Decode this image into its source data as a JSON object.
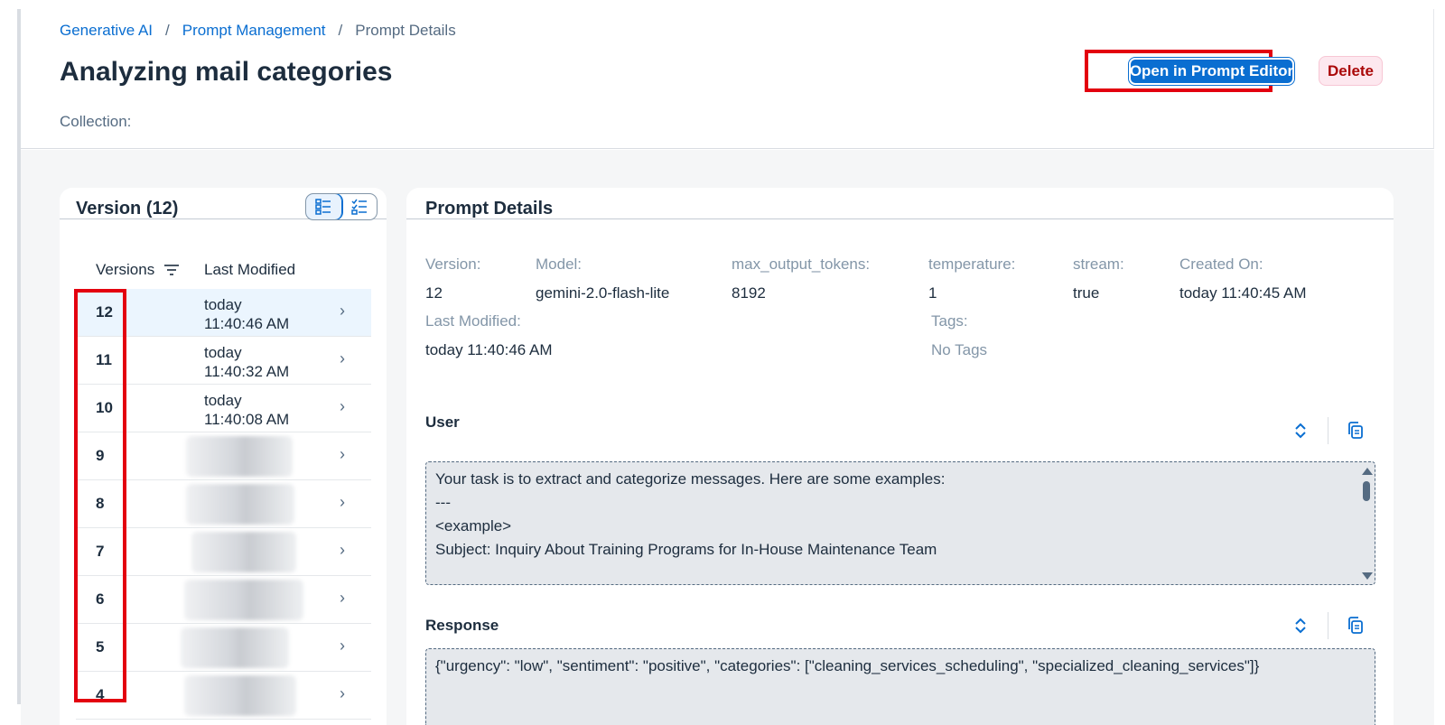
{
  "breadcrumb": {
    "items": [
      "Generative AI",
      "Prompt Management"
    ],
    "separator": "/",
    "current": "Prompt Details"
  },
  "page": {
    "title": "Analyzing mail categories",
    "collection_label": "Collection:"
  },
  "actions": {
    "open_editor_label": "Open in Prompt Editor",
    "delete_label": "Delete"
  },
  "versions": {
    "title": "Version (12)",
    "columns": {
      "versions": "Versions",
      "last_modified": "Last Modified"
    },
    "rows": [
      {
        "num": "12",
        "mod_day": "today",
        "mod_time": "11:40:46 AM",
        "selected": true
      },
      {
        "num": "11",
        "mod_day": "today",
        "mod_time": "11:40:32 AM"
      },
      {
        "num": "10",
        "mod_day": "today",
        "mod_time": "11:40:08 AM"
      },
      {
        "num": "9"
      },
      {
        "num": "8"
      },
      {
        "num": "7"
      },
      {
        "num": "6"
      },
      {
        "num": "5"
      },
      {
        "num": "4"
      }
    ],
    "chevron": "›"
  },
  "details": {
    "title": "Prompt Details",
    "version_label": "Version:",
    "version_value": "12",
    "model_label": "Model:",
    "model_value": "gemini-2.0-flash-lite",
    "max_tokens_label": "max_output_tokens:",
    "max_tokens_value": "8192",
    "temperature_label": "temperature:",
    "temperature_value": "1",
    "stream_label": "stream:",
    "stream_value": "true",
    "created_label": "Created On:",
    "created_value": "today 11:40:45 AM",
    "last_modified_label": "Last Modified:",
    "last_modified_value": "today 11:40:46 AM",
    "tags_label": "Tags:",
    "tags_value": "No Tags"
  },
  "user_section": {
    "title": "User",
    "lines": [
      "Your task is to extract and categorize messages. Here are some examples:",
      "---",
      "<example>",
      "Subject: Inquiry About Training Programs for In-House Maintenance Team"
    ]
  },
  "response_section": {
    "title": "Response",
    "text": "{\"urgency\": \"low\", \"sentiment\": \"positive\", \"categories\": [\"cleaning_services_scheduling\", \"specialized_cleaning_services\"]}"
  },
  "icons": {
    "list_view": "list-view-icon",
    "checklist_view": "checklist-view-icon",
    "sort": "sort-icon",
    "expand": "expand-collapse-icon",
    "copy": "copy-icon"
  },
  "colors": {
    "accent": "#0a6ed1",
    "highlight": "#e3000f",
    "delete_bg": "#fde8ef",
    "delete_text": "#aa0808"
  }
}
